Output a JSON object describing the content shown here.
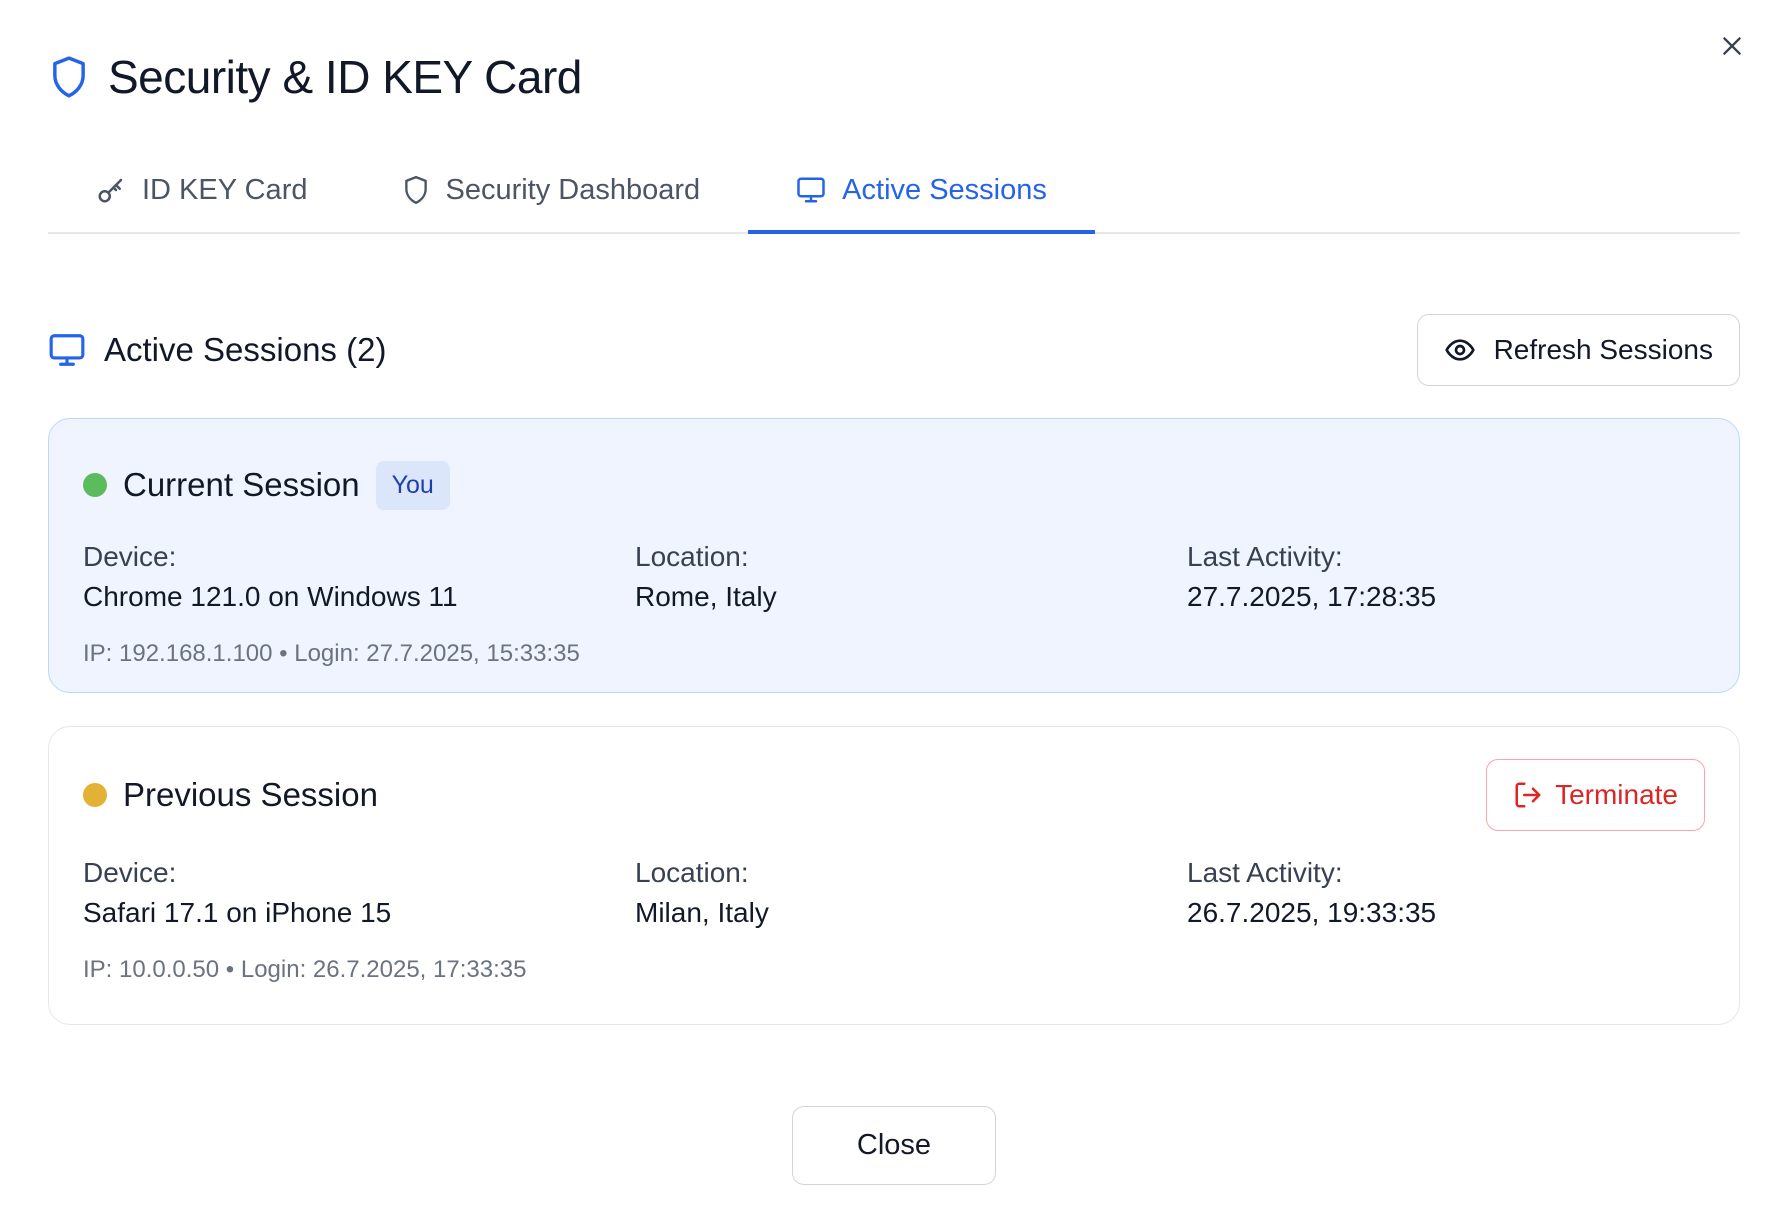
{
  "dialog": {
    "title": "Security & ID KEY Card",
    "close_icon": "close-icon"
  },
  "tabs": [
    {
      "label": "ID KEY Card",
      "icon": "key-icon",
      "active": false
    },
    {
      "label": "Security Dashboard",
      "icon": "shield-icon",
      "active": false
    },
    {
      "label": "Active Sessions",
      "icon": "monitor-icon",
      "active": true
    }
  ],
  "section": {
    "title": "Active Sessions (2)",
    "refresh_label": "Refresh Sessions"
  },
  "sessions": [
    {
      "title": "Current Session",
      "badge": "You",
      "status_color": "#5cbb5c",
      "device_label": "Device:",
      "device": "Chrome 121.0 on Windows 11",
      "location_label": "Location:",
      "location": "Rome, Italy",
      "activity_label": "Last Activity:",
      "activity": "27.7.2025, 17:28:35",
      "meta": "IP: 192.168.1.100 • Login: 27.7.2025, 15:33:35"
    },
    {
      "title": "Previous Session",
      "status_color": "#e2b237",
      "terminate_label": "Terminate",
      "device_label": "Device:",
      "device": "Safari 17.1 on iPhone 15",
      "location_label": "Location:",
      "location": "Milan, Italy",
      "activity_label": "Last Activity:",
      "activity": "26.7.2025, 19:33:35",
      "meta": "IP: 10.0.0.50 • Login: 26.7.2025, 17:33:35"
    }
  ],
  "footer": {
    "close_label": "Close"
  },
  "colors": {
    "accent": "#2563eb",
    "danger": "#dc2626",
    "current_card_bg": "#eff4fe"
  }
}
